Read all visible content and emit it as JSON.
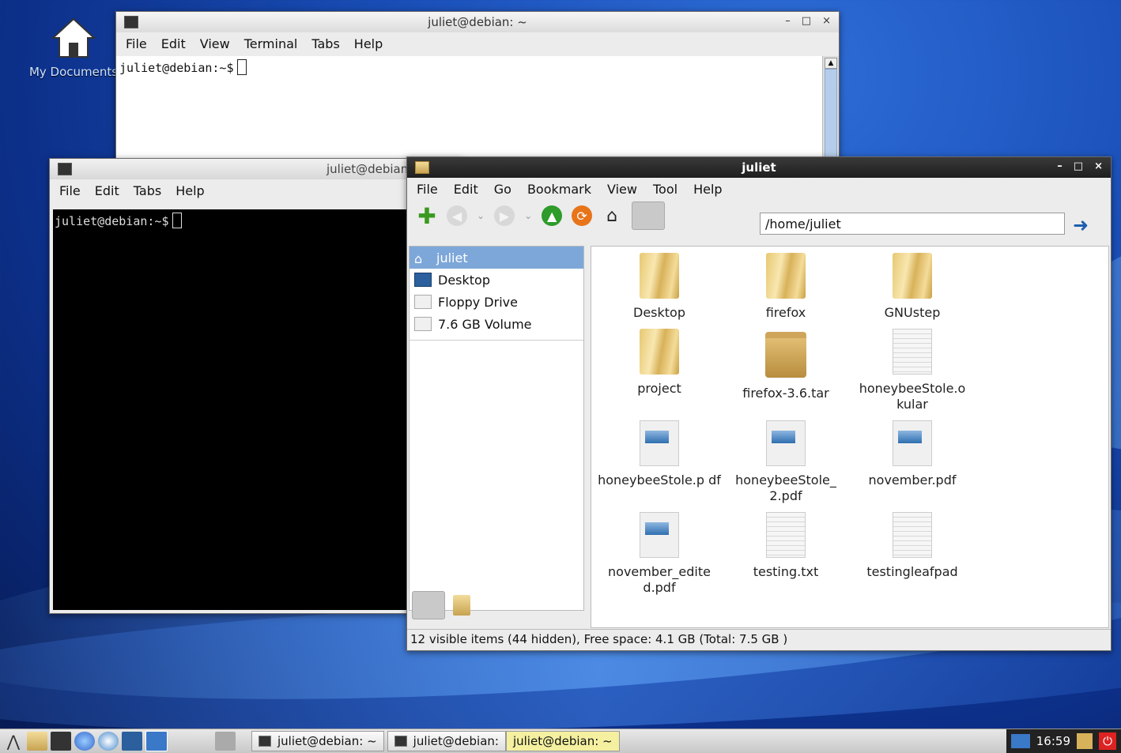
{
  "desktop": {
    "icon_label": "My Documents"
  },
  "terminal1": {
    "title": "juliet@debian: ~",
    "menu": [
      "File",
      "Edit",
      "View",
      "Terminal",
      "Tabs",
      "Help"
    ],
    "prompt": "juliet@debian:~$",
    "controls": [
      "–",
      "□",
      "×"
    ]
  },
  "terminal2": {
    "title": "juliet@debian: ~",
    "menu": [
      "File",
      "Edit",
      "Tabs",
      "Help"
    ],
    "prompt": "juliet@debian:~$"
  },
  "filemanager": {
    "title": "juliet",
    "controls": [
      "–",
      "□",
      "×"
    ],
    "menu": [
      "File",
      "Edit",
      "Go",
      "Bookmark",
      "View",
      "Tool",
      "Help"
    ],
    "address": "/home/juliet",
    "sidebar": [
      {
        "label": "juliet",
        "icon": "home-icon",
        "selected": true
      },
      {
        "label": "Desktop",
        "icon": "desktop-icon"
      },
      {
        "label": "Floppy Drive",
        "icon": "floppy-icon"
      },
      {
        "label": "7.6 GB Volume",
        "icon": "drive-icon"
      }
    ],
    "files": [
      {
        "name": "Desktop",
        "type": "folder"
      },
      {
        "name": "firefox",
        "type": "folder"
      },
      {
        "name": "GNUstep",
        "type": "folder"
      },
      {
        "name": "project",
        "type": "folder"
      },
      {
        "name": "firefox-3.6.tar",
        "type": "archive"
      },
      {
        "name": "honeybeeStole.o kular",
        "type": "text"
      },
      {
        "name": "honeybeeStole.p df",
        "type": "pdf"
      },
      {
        "name": "honeybeeStole_ 2.pdf",
        "type": "pdf"
      },
      {
        "name": "november.pdf",
        "type": "pdf"
      },
      {
        "name": "november_edite d.pdf",
        "type": "pdf"
      },
      {
        "name": "testing.txt",
        "type": "text"
      },
      {
        "name": "testingleafpad",
        "type": "text"
      }
    ],
    "status": "12 visible items (44 hidden), Free space: 4.1 GB (Total: 7.5 GB )"
  },
  "taskbar": {
    "tasks": [
      "juliet@debian: ~",
      "juliet@debian:",
      "juliet@debian: ~"
    ],
    "clock": "16:59"
  }
}
